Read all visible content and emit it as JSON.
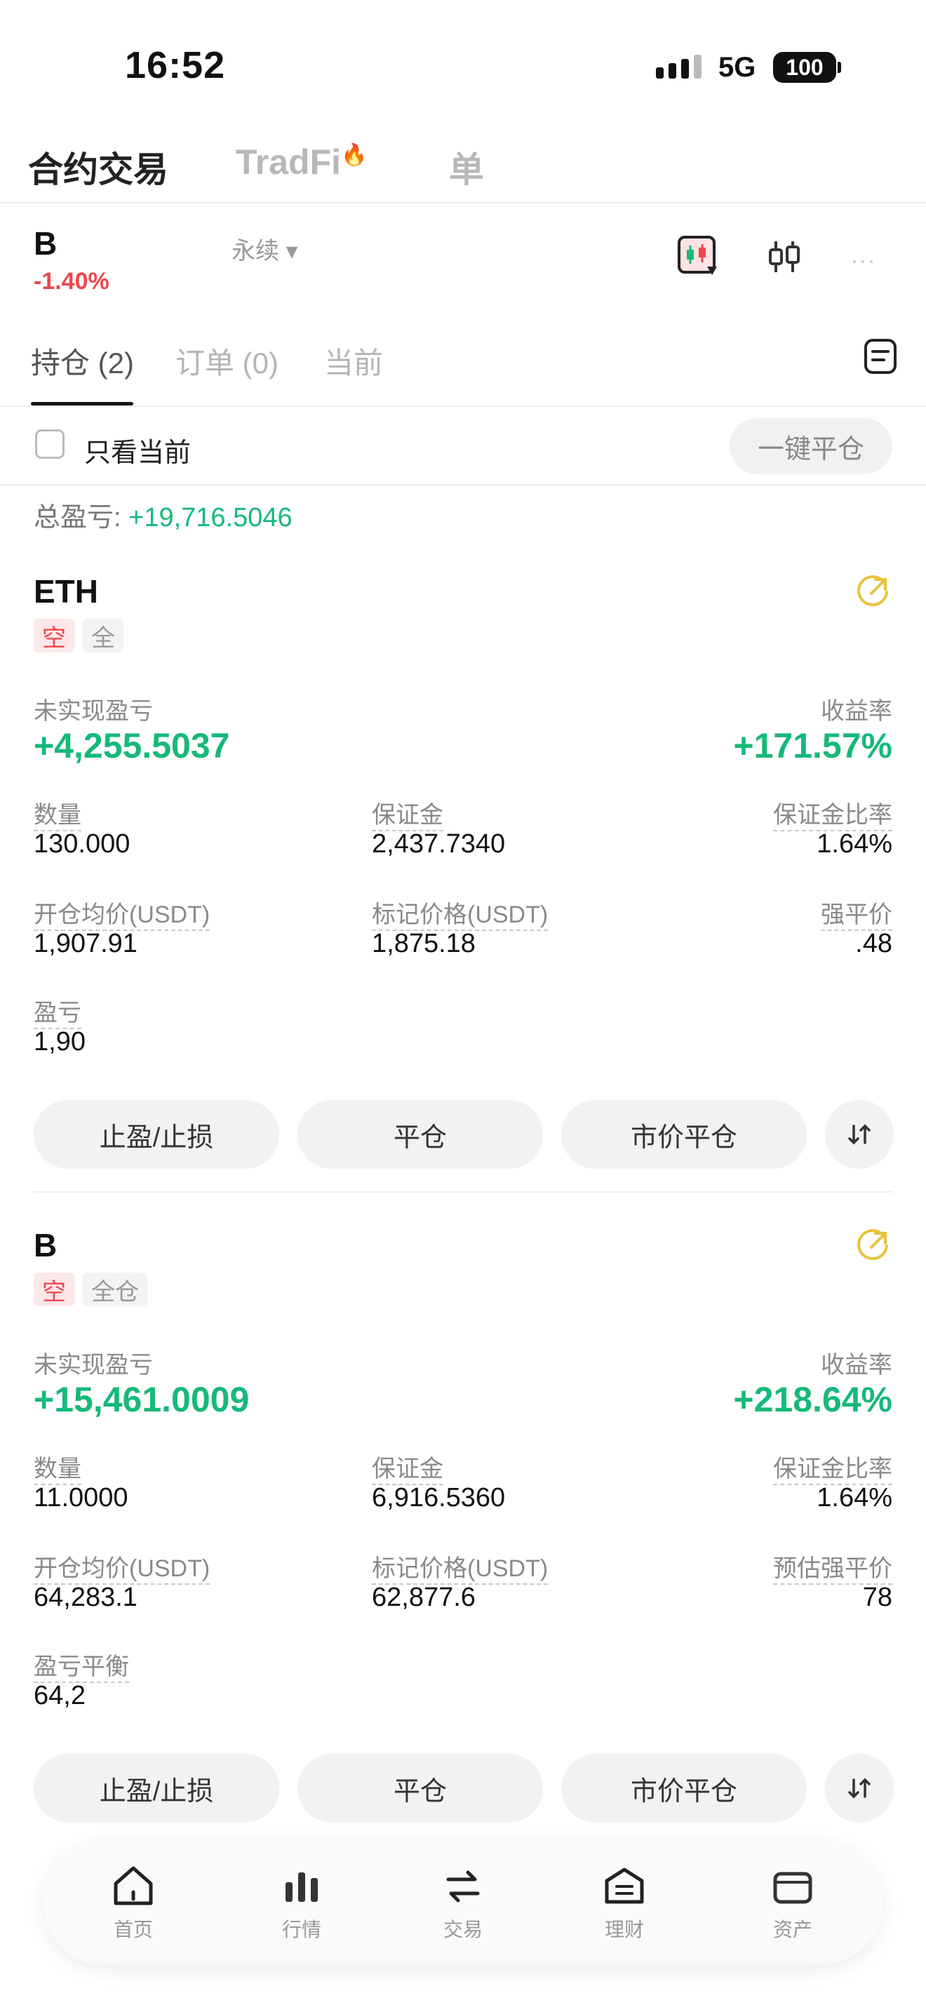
{
  "status": {
    "time": "16:52",
    "network": "5G",
    "battery": "100"
  },
  "top_tabs": [
    {
      "label": "合约交易"
    },
    {
      "label": "TradFi"
    },
    {
      "label": "单"
    }
  ],
  "pair": {
    "name": "B",
    "type": "永续",
    "change": "-1.40%"
  },
  "sub_tabs": [
    {
      "label": "持仓 (2)"
    },
    {
      "label": "订单 (0)"
    },
    {
      "label": "当前"
    }
  ],
  "filter": {
    "label": "只看当前",
    "close_all": "一键平仓"
  },
  "total": {
    "label": "总盈亏: ",
    "value": "+19,716.5046"
  },
  "positions": [
    {
      "symbol": "ETH",
      "side": "空",
      "mode": "全",
      "unrealized_label": "未实现盈亏",
      "unrealized": "+4,255.5037",
      "roi_label": "收益率",
      "roi": "+171.57%",
      "qty_label": "数量",
      "qty": "130.000",
      "margin_label": "保证金",
      "margin": "2,437.7340",
      "margin_ratio_label": "保证金比率",
      "margin_ratio": "1.64%",
      "entry_label": "开仓均价(USDT)",
      "entry": "1,907.91",
      "mark_label": "标记价格(USDT)",
      "mark": "1,875.18",
      "liq_label": "强平价",
      "liq": ".48",
      "be_label": "盈亏",
      "be": "1,90",
      "btn_tpsl": "止盈/止损",
      "btn_close": "平仓",
      "btn_market": "市价平仓"
    },
    {
      "symbol": "B",
      "side": "空",
      "mode": "全仓",
      "unrealized_label": "未实现盈亏",
      "unrealized": "+15,461.0009",
      "roi_label": "收益率",
      "roi": "+218.64%",
      "qty_label": "数量",
      "qty": "11.0000",
      "margin_label": "保证金",
      "margin": "6,916.5360",
      "margin_ratio_label": "保证金比率",
      "margin_ratio": "1.64%",
      "entry_label": "开仓均价(USDT)",
      "entry": "64,283.1",
      "mark_label": "标记价格(USDT)",
      "mark": "62,877.6",
      "liq_label": "预估强平价",
      "liq": "78",
      "be_label": "盈亏平衡",
      "be": "64,2",
      "btn_tpsl": "止盈/止损",
      "btn_close": "平仓",
      "btn_market": "市价平仓"
    }
  ],
  "nav": [
    {
      "label": "首页",
      "icon": "home-icon"
    },
    {
      "label": "行情",
      "icon": "market-icon"
    },
    {
      "label": "交易",
      "icon": "trade-icon"
    },
    {
      "label": "理财",
      "icon": "earn-icon"
    },
    {
      "label": "资产",
      "icon": "wallet-icon"
    }
  ],
  "colors": {
    "green": "#16b979",
    "red": "#f0464e",
    "yellow": "#e8c23b"
  }
}
